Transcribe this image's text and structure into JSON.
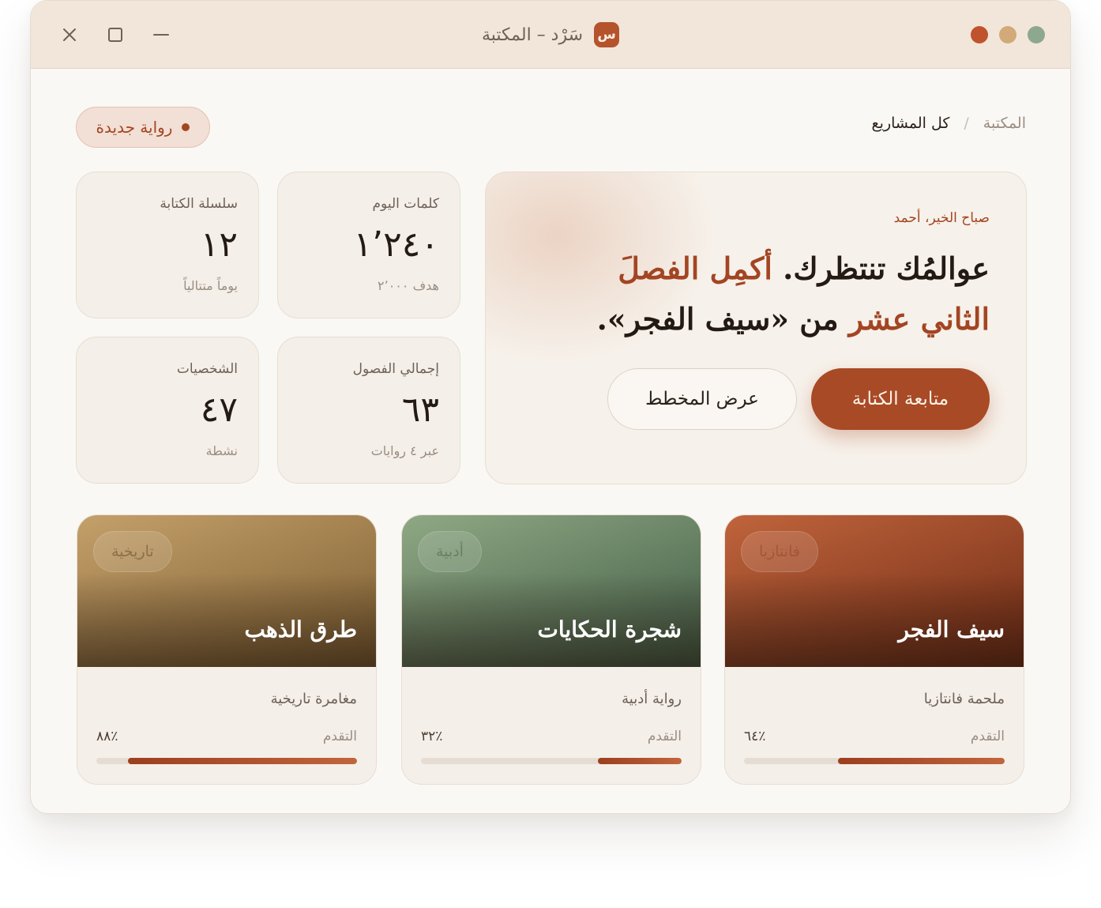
{
  "window": {
    "title": "سَرْد – المكتبة",
    "logo_letter": "س",
    "dots": [
      "#c0532d",
      "#d1aa78",
      "#8ea88f"
    ]
  },
  "breadcrumb": {
    "root": "المكتبة",
    "separator": "/",
    "current": "كل المشاريع"
  },
  "new_novel_label": "رواية جديدة",
  "hero": {
    "greeting": "صباح الخير، أحمد",
    "headline_1": "عوالمُك تنتظرك. ",
    "headline_accent": "أكمِل الفصلَ الثاني عشر",
    "headline_2": " من «سيف الفجر».",
    "primary_label": "متابعة الكتابة",
    "secondary_label": "عرض المخطط"
  },
  "stats": [
    {
      "label": "كلمات اليوم",
      "value": "١٬٢٤٠",
      "sub": "هدف ٢٬٠٠٠"
    },
    {
      "label": "سلسلة الكتابة",
      "value": "١٢",
      "sub": "يوماً متتالياً"
    },
    {
      "label": "إجمالي الفصول",
      "value": "٦٣",
      "sub": "عبر ٤ روايات"
    },
    {
      "label": "الشخصيات",
      "value": "٤٧",
      "sub": "نشطة"
    }
  ],
  "books": [
    {
      "genre": "فانتازيا",
      "title": "سيف الفجر",
      "subtitle": "ملحمة فانتازيا",
      "progress_label": "التقدم",
      "progress_text": "٪٦٤",
      "progress": 0.64,
      "cover_from": "#c0643c",
      "cover_to": "#6e2a14",
      "pill_color": "#a0573a"
    },
    {
      "genre": "أدبية",
      "title": "شجرة الحكايات",
      "subtitle": "رواية أدبية",
      "progress_label": "التقدم",
      "progress_text": "٪٣٢",
      "progress": 0.32,
      "cover_from": "#8fa884",
      "cover_to": "#405a44",
      "pill_color": "#6d7f63"
    },
    {
      "genre": "تاريخية",
      "title": "طرق الذهب",
      "subtitle": "مغامرة تاريخية",
      "progress_label": "التقدم",
      "progress_text": "٪٨٨",
      "progress": 0.88,
      "cover_from": "#c4a06a",
      "cover_to": "#7a5c30",
      "pill_color": "#8a7148"
    }
  ]
}
